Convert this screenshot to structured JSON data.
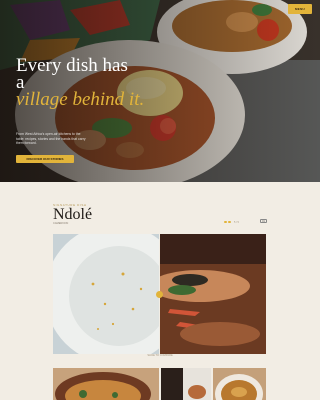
{
  "hero": {
    "menu_label": "MENU",
    "title_line1": "Every dish has",
    "title_line2": "a",
    "title_accent": "village behind it.",
    "subtitle": "From West Africa's open-air kitchens to the table: recipes, stories and the hands that carry them forward.",
    "cta_label": "DISCOVER OUR STORIES"
  },
  "section": {
    "kicker": "SIGNATURE DISH",
    "title": "Ndolé",
    "subtitle": "CAMEROON",
    "rating_text": "5 / 5",
    "badge": "01",
    "caption": "SLIDE TO COMPARE"
  },
  "colors": {
    "accent": "#e2b43a",
    "page_background": "#f2ede4",
    "title_text": "#1e1a16"
  }
}
